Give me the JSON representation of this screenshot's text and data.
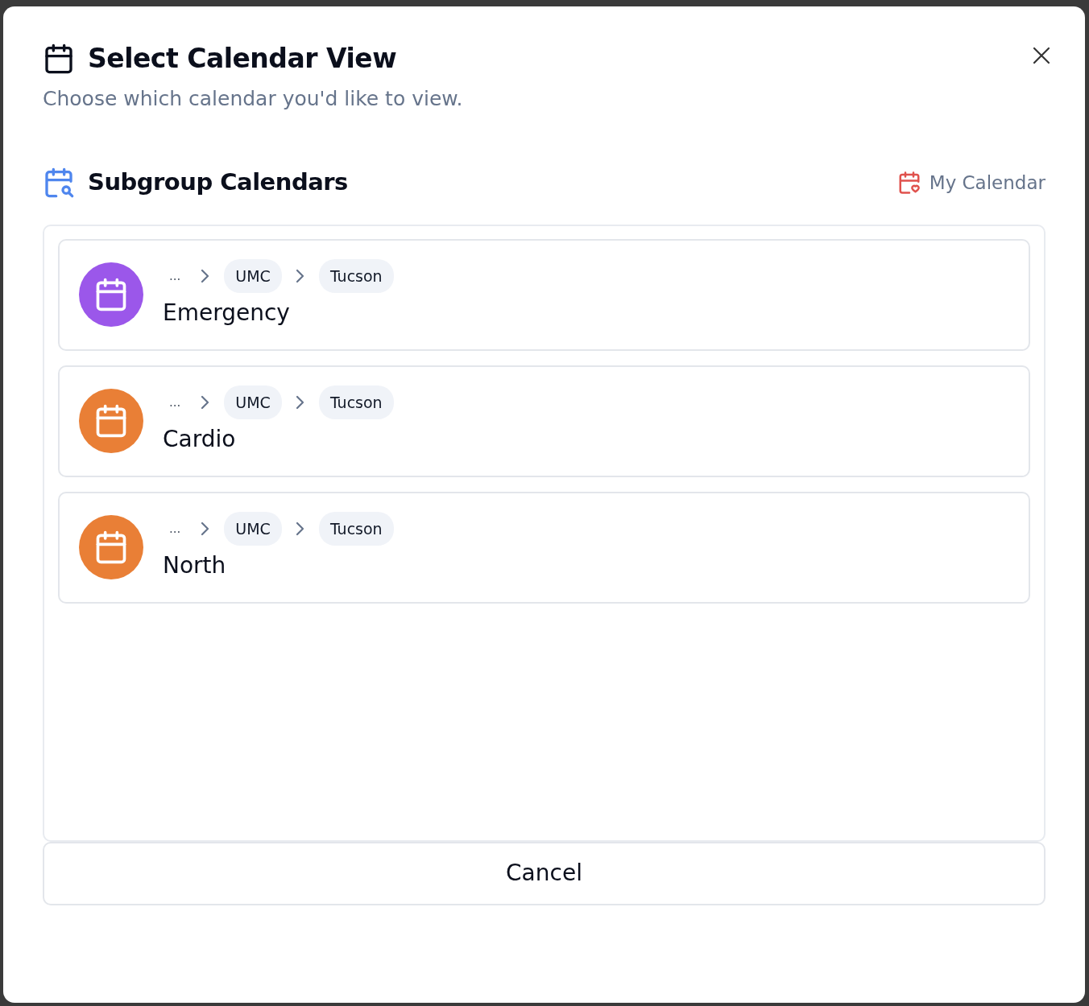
{
  "dialog": {
    "title": "Select Calendar View",
    "subtitle": "Choose which calendar you'd like to view."
  },
  "section": {
    "title": "Subgroup Calendars",
    "link": "My Calendar"
  },
  "calendars": [
    {
      "name": "Emergency",
      "color": "#9b57ea",
      "path": [
        "...",
        "UMC",
        "Tucson"
      ]
    },
    {
      "name": "Cardio",
      "color": "#e97f36",
      "path": [
        "...",
        "UMC",
        "Tucson"
      ]
    },
    {
      "name": "North",
      "color": "#e97f36",
      "path": [
        "...",
        "UMC",
        "Tucson"
      ]
    }
  ],
  "buttons": [
    "Cancel"
  ]
}
